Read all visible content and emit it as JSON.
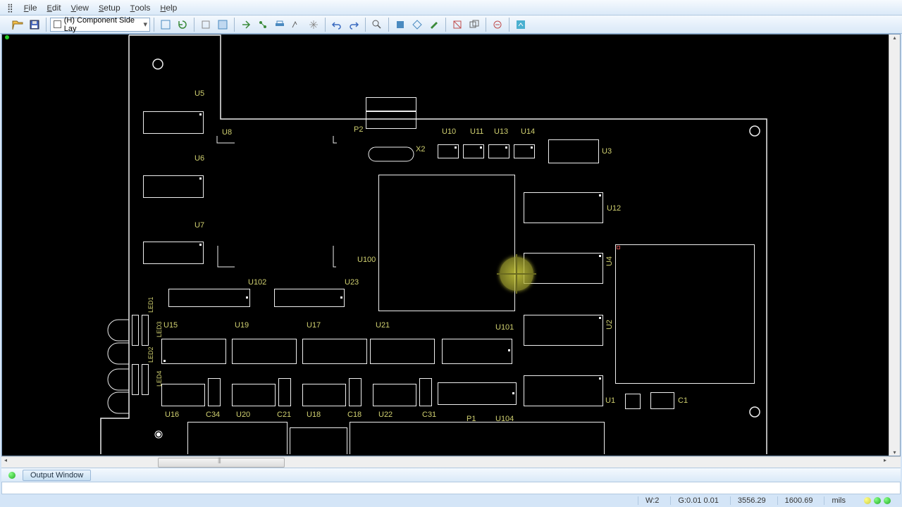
{
  "menu": {
    "file": "File",
    "edit": "Edit",
    "view": "View",
    "setup": "Setup",
    "tools": "Tools",
    "help": "Help"
  },
  "toolbar": {
    "layer_selected": "(H) Component Side Lay"
  },
  "output": {
    "btn": "Output Window"
  },
  "status": {
    "w": "W:2",
    "g": "G:0.01 0.01",
    "x": "3556.29",
    "y": "1600.69",
    "units": "mils"
  },
  "labels": {
    "U5": "U5",
    "U6": "U6",
    "U7": "U7",
    "U8": "U8",
    "P2": "P2",
    "X2": "X2",
    "U10": "U10",
    "U11": "U11",
    "U13": "U13",
    "U14": "U14",
    "U3": "U3",
    "U100": "U100",
    "U12": "U12",
    "U102": "U102",
    "U23": "U23",
    "U15": "U15",
    "U19": "U19",
    "U17": "U17",
    "U21": "U21",
    "U101": "U101",
    "U2": "U2",
    "U4": "U4",
    "U1": "U1",
    "C1": "C1",
    "U16": "U16",
    "C34": "C34",
    "U20": "U20",
    "C21": "C21",
    "U18": "U18",
    "C18": "C18",
    "U22": "U22",
    "C31": "C31",
    "P1": "P1",
    "U104": "U104",
    "LED1": "LED1",
    "LED2": "LED2",
    "LED3": "LED3",
    "LED4": "LED4"
  }
}
